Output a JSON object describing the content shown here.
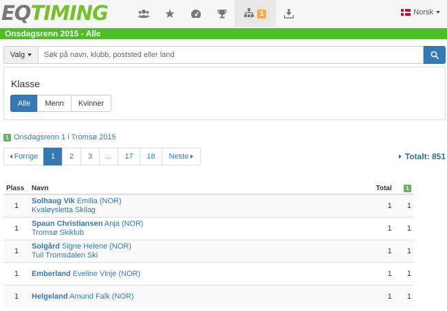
{
  "nav": {
    "logo_eq": "EQ",
    "logo_timing": "TIMING",
    "icons": [
      "users-icon",
      "star-icon",
      "dashboard-icon",
      "trophy-icon",
      "sitemap-icon",
      "download-icon"
    ],
    "active_badge": "1",
    "language": "Norsk"
  },
  "title": "Onsdagsrenn 2015 - Alle",
  "search": {
    "dropdown_label": "Valg",
    "placeholder": "Søk på navn, klubb, poststed eller land"
  },
  "classes": {
    "heading": "Klasse",
    "options": [
      "Alle",
      "Menn",
      "Kvinner"
    ],
    "selected": "Alle"
  },
  "event": {
    "badge": "1",
    "label": "Onsdagsrenn 1 i Tromsø 2015"
  },
  "pagination": {
    "prev": "Forrige",
    "pages": [
      "1",
      "2",
      "3",
      "...",
      "17",
      "18"
    ],
    "current": "1",
    "next": "Neste"
  },
  "total_label": "Totalt: 851",
  "table": {
    "headers": {
      "plass": "Plass",
      "navn": "Navn",
      "total": "Total",
      "race_badge": "1"
    },
    "rows": [
      {
        "plass": "1",
        "surname": "Solhaug Vik",
        "given": "Emilia (NOR)",
        "club": "Kvaløysletta Skilag",
        "total": "1",
        "race": "1"
      },
      {
        "plass": "1",
        "surname": "Spaun Christiansen",
        "given": "Anja (NOR)",
        "club": "Tromsø Skiklub",
        "total": "1",
        "race": "1"
      },
      {
        "plass": "1",
        "surname": "Solgård",
        "given": "Signe Helene (NOR)",
        "club": "Tuil Tromsdalen Ski",
        "total": "1",
        "race": "1"
      },
      {
        "plass": "1",
        "surname": "Emberland",
        "given": "Eveline Vinje (NOR)",
        "club": "",
        "total": "1",
        "race": "1"
      },
      {
        "plass": "1",
        "surname": "Helgeland",
        "given": "Amund Falk (NOR)",
        "club": "",
        "total": "1",
        "race": "1"
      }
    ]
  }
}
